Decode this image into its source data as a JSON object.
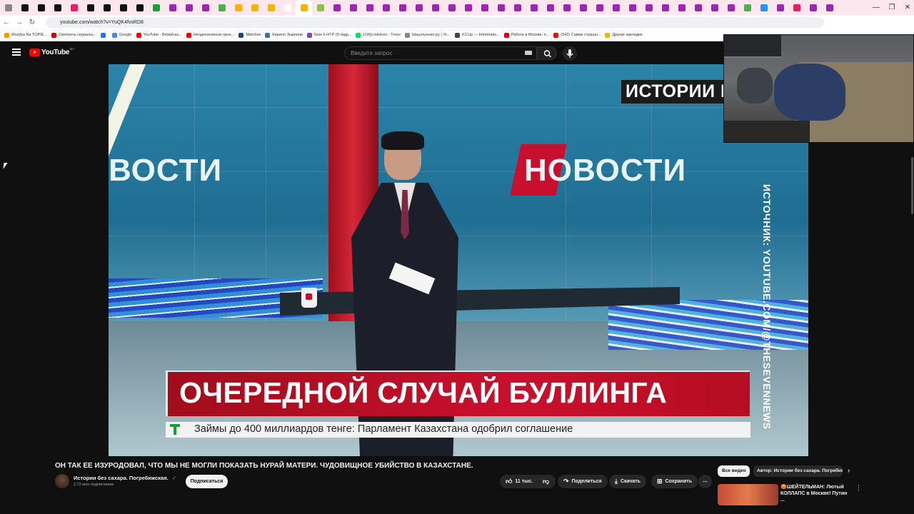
{
  "browser": {
    "tabs_count": 51,
    "url": "youtube.com/watch?v=YuQK4fvsRD8",
    "bookmarks": [
      {
        "label": "Muzyka Na TOPIE...",
        "color": "#ff9900"
      },
      {
        "label": "Смотреть сериалы...",
        "color": "#cc0000"
      },
      {
        "label": "",
        "color": "#1877f2"
      },
      {
        "label": "Google",
        "color": "#4285f4"
      },
      {
        "label": "YouTube - Broadcas...",
        "color": "#ff0000"
      },
      {
        "label": "Неоднозначное прох...",
        "color": "#ff0000"
      },
      {
        "label": "Matches",
        "color": "#2a3f7a"
      },
      {
        "label": "Кирилл Зырянов",
        "color": "#3a6fb0"
      },
      {
        "label": "Now 5-HTP (5-гидр...",
        "color": "#7b4ab8"
      },
      {
        "label": "(1W)LinkHoro - Trovo",
        "color": "#19d66b"
      },
      {
        "label": "Шашлычная ру | Ус...",
        "color": "#888888"
      },
      {
        "label": "iCCup — Informatio...",
        "color": "#444444"
      },
      {
        "label": "Работа в Москве, п...",
        "color": "#d6001c"
      },
      {
        "label": "(542) Самая страшн...",
        "color": "#ff0000"
      },
      {
        "label": "Другие закладки",
        "color": "#f4b400"
      }
    ]
  },
  "youtube": {
    "logo_text": "YouTube",
    "logo_region": "BY",
    "search_placeholder": "Введите запрос"
  },
  "video": {
    "corner_tag": "ИСТОРИИ БЕЗ",
    "studio_brand": "НОВОСТИ",
    "studio_brand_partial": "ВОСТИ",
    "source_caption": "ИСТОЧНИК: YOUTUBE.COM/@THESEVENNEWS",
    "headline": "ОЧЕРЕДНОЙ СЛУЧАЙ БУЛЛИНГА",
    "ticker": "Займы до 400 миллиардов тенге: Парламент Казахстана одобрил соглашение"
  },
  "below": {
    "title": "ОН ТАК ЕЕ ИЗУРОДОВАЛ, ЧТО МЫ НЕ МОГЛИ ПОКАЗАТЬ НУРАЙ МАТЕРИ. ЧУДОВИЩНОЕ УБИЙСТВО В КАЗАХСТАНЕ.",
    "channel": "Истории без сахара. Погребижская.",
    "verified_mark": "✓",
    "subscribers": "2,72 млн подписчиков",
    "subscribe": "Подписаться",
    "likes": "11 тыс.",
    "share": "Поделиться",
    "download": "Скачать",
    "save": "Сохранить",
    "more": "⋯"
  },
  "sidebar": {
    "chips": {
      "all": "Все видео",
      "author": "Автор: Истории без сахара. Погребижская"
    },
    "rec_title": "😡ШЕЙТЕЛЬМАН: Лютый КОЛЛАПС в Москве! Путин ..."
  },
  "icons": [
    "menu-icon",
    "search-icon",
    "mic-icon",
    "keyboard-icon",
    "like-icon",
    "dislike-icon",
    "share-icon",
    "download-icon",
    "save-icon",
    "chevron-right-icon",
    "more-icon"
  ]
}
